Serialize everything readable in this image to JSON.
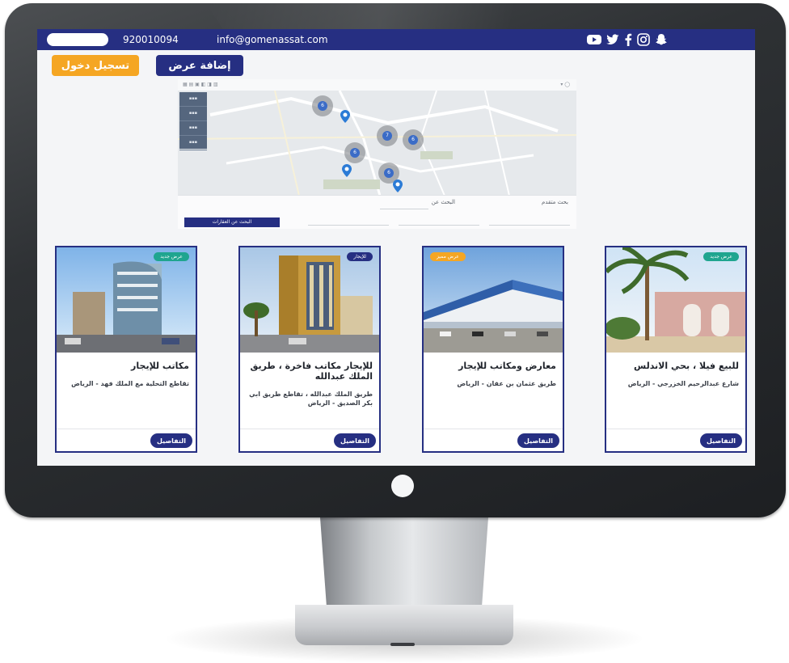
{
  "header": {
    "phone": "920010094",
    "email": "info@gomenassat.com",
    "social_icons": [
      "youtube-icon",
      "twitter-icon",
      "facebook-icon",
      "instagram-icon",
      "snapchat-icon"
    ]
  },
  "actions": {
    "login_label": "تسجيل دخول",
    "add_offer_label": "إضافة عرض"
  },
  "map": {
    "search_title": "بحث متقدم",
    "search_for_label": "البحث عن",
    "submit_label": "البحث عن العقارات",
    "clusters": [
      "6",
      "7",
      "6",
      "6",
      "6"
    ]
  },
  "listings": [
    {
      "badge": "عرض جديد",
      "badge_color": "#1fa58f",
      "title": "للبيع فيلا ، بحي الاندلس",
      "address": "شارع عبدالرحيم الخزرجي - الرياض",
      "details_label": "التفاصيل"
    },
    {
      "badge": "عرض مميز",
      "badge_color": "#f5a623",
      "title": "معارض ومكاتب للإيجار",
      "address": "طريق عثمان بن عفان - الرياض",
      "details_label": "التفاصيل"
    },
    {
      "badge": "للإيجار",
      "badge_color": "#262f82",
      "title": "للإيجار مكاتب فاخرة ، طريق الملك عبدالله",
      "address": "طريق الملك عبدالله ، تقاطع طريق ابي بكر الصديق - الرياض",
      "details_label": "التفاصيل"
    },
    {
      "badge": "عرض جديد",
      "badge_color": "#1fa58f",
      "title": "مكاتب للإيجار",
      "address": "تقاطع التحلية مع الملك فهد - الرياض",
      "details_label": "التفاصيل"
    }
  ],
  "colors": {
    "brand": "#262f82",
    "accent": "#f5a623"
  }
}
